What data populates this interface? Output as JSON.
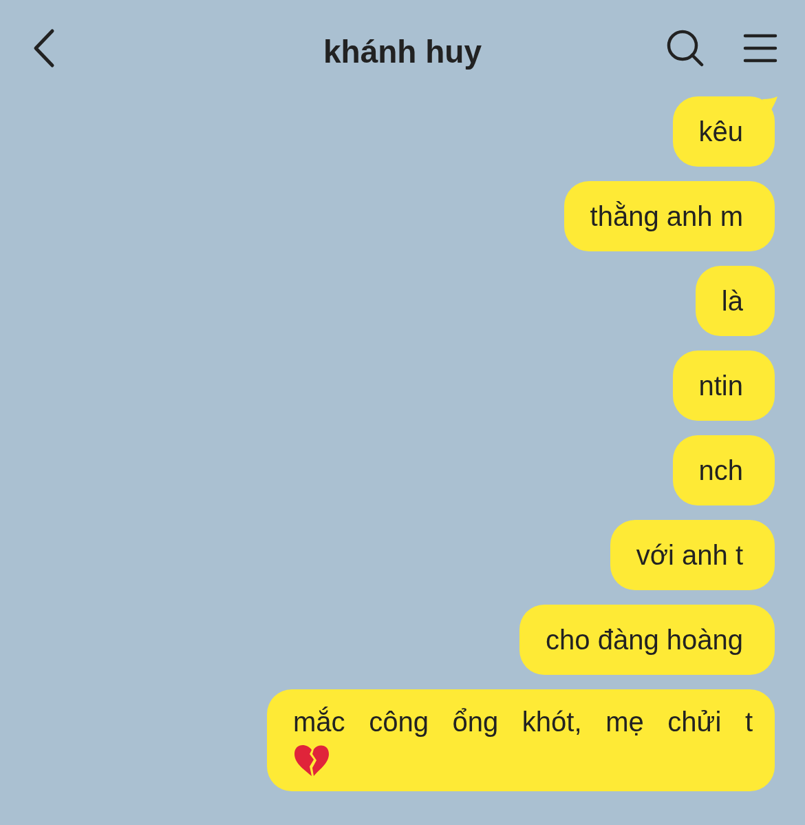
{
  "header": {
    "title": "khánh huy"
  },
  "messages": [
    {
      "text": "kêu",
      "tail": true
    },
    {
      "text": "thằng anh m",
      "tail": false
    },
    {
      "text": "là",
      "tail": false
    },
    {
      "text": "ntin",
      "tail": false
    },
    {
      "text": "nch",
      "tail": false
    },
    {
      "text": "với anh t",
      "tail": false
    },
    {
      "text": "cho đàng hoàng",
      "tail": false
    },
    {
      "text": "mắc công ổng khót, mẹ chửi t",
      "tail": false,
      "trailing_icon": true
    }
  ]
}
